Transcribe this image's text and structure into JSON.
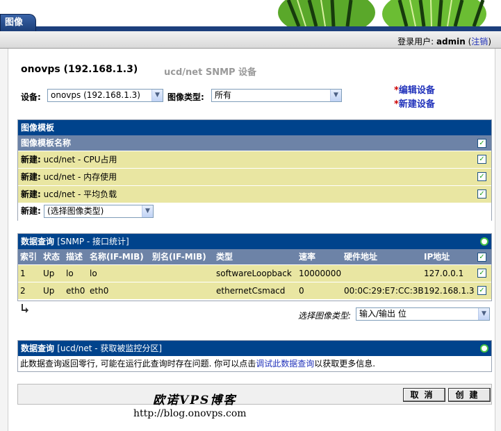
{
  "nav": {
    "active_tab": "图像"
  },
  "login": {
    "prefix": "登录用户:",
    "user": "admin",
    "logout": "注销"
  },
  "device": {
    "title": "onovps (192.168.1.3)",
    "template": "ucd/net SNMP 设备",
    "device_label": "设备:",
    "device_value": "onovps (192.168.1.3)",
    "graph_type_label": "图像类型:",
    "graph_type_value": "所有",
    "edit_link": "编辑设备",
    "new_link": "新建设备",
    "star": "*"
  },
  "graph_templates": {
    "title": "图像模板",
    "column": "图像模板名称",
    "rows": [
      {
        "prefix": "新建:",
        "name": "ucd/net - CPU占用"
      },
      {
        "prefix": "新建:",
        "name": "ucd/net - 内存使用"
      },
      {
        "prefix": "新建:",
        "name": "ucd/net - 平均负载"
      }
    ],
    "new_label": "新建:",
    "new_select": "(选择图像类型)"
  },
  "dq_interfaces": {
    "title": "数据查询",
    "subtitle": "[SNMP - 接口统计]",
    "columns": [
      "索引",
      "状态",
      "描述",
      "名称(IF-MIB)",
      "别名(IF-MIB)",
      "类型",
      "速率",
      "硬件地址",
      "IP地址"
    ],
    "rows": [
      [
        "1",
        "Up",
        "lo",
        "lo",
        "",
        "softwareLoopback",
        "10000000",
        "",
        "127.0.0.1"
      ],
      [
        "2",
        "Up",
        "eth0",
        "eth0",
        "",
        "ethernetCsmacd",
        "0",
        "00:0C:29:E7:CC:3B",
        "192.168.1.3"
      ]
    ],
    "select_label": "选择图像类型:",
    "select_value": "输入/输出 位"
  },
  "dq_partitions": {
    "title": "数据查询",
    "subtitle": "[ucd/net - 获取被监控分区]",
    "msg_before": "此数据查询返回零行, 可能在运行此查询时存在问题. 你可以点击",
    "msg_link": "调试此数据查询",
    "msg_after": "以获取更多信息."
  },
  "footer": {
    "cancel": "取消",
    "create": "创建",
    "watermark_cn": "欧诺VPS博客",
    "watermark_url": "http://blog.onovps.com"
  },
  "colors": {
    "header_blue": "#00438c",
    "subheader": "#6d83a7",
    "row_yellow": "#e9e6a2",
    "link": "#2233bb"
  }
}
